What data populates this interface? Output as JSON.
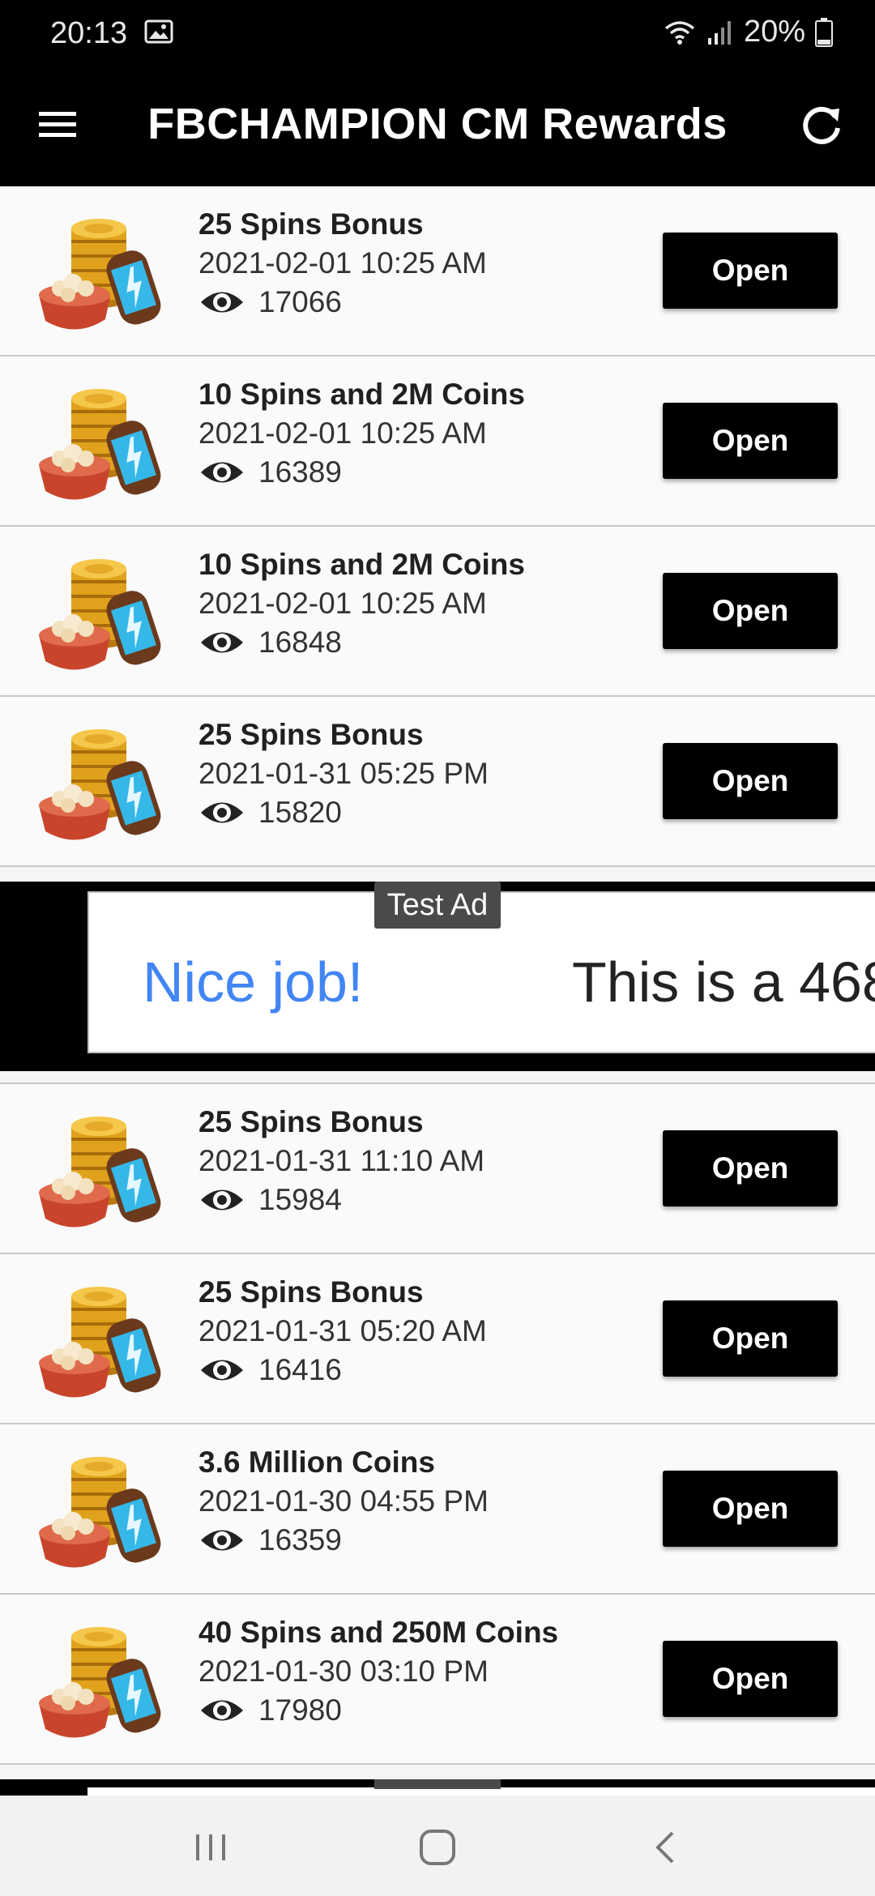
{
  "status_bar": {
    "time": "20:13",
    "battery": "20%"
  },
  "app_bar": {
    "title": "FBCHAMPION CM Rewards"
  },
  "rows": [
    {
      "title": "25 Spins Bonus",
      "date": "2021-02-01 10:25 AM",
      "views": "17066",
      "button": "Open"
    },
    {
      "title": "10 Spins and 2M Coins",
      "date": "2021-02-01 10:25 AM",
      "views": "16389",
      "button": "Open"
    },
    {
      "title": "10 Spins and 2M Coins",
      "date": "2021-02-01 10:25 AM",
      "views": "16848",
      "button": "Open"
    },
    {
      "title": "25 Spins Bonus",
      "date": "2021-01-31 05:25 PM",
      "views": "15820",
      "button": "Open"
    },
    {
      "title": "25 Spins Bonus",
      "date": "2021-01-31 11:10 AM",
      "views": "15984",
      "button": "Open"
    },
    {
      "title": "25 Spins Bonus",
      "date": "2021-01-31 05:20 AM",
      "views": "16416",
      "button": "Open"
    },
    {
      "title": "3.6 Million Coins",
      "date": "2021-01-30 04:55 PM",
      "views": "16359",
      "button": "Open"
    },
    {
      "title": "40 Spins and 250M Coins",
      "date": "2021-01-30 03:10 PM",
      "views": "17980",
      "button": "Open"
    }
  ],
  "ad": {
    "label": "Test Ad",
    "headline": "Nice job!",
    "text": "This is a 468"
  },
  "colors": {
    "bar": "#000000",
    "ad_blue": "#4285f4"
  }
}
